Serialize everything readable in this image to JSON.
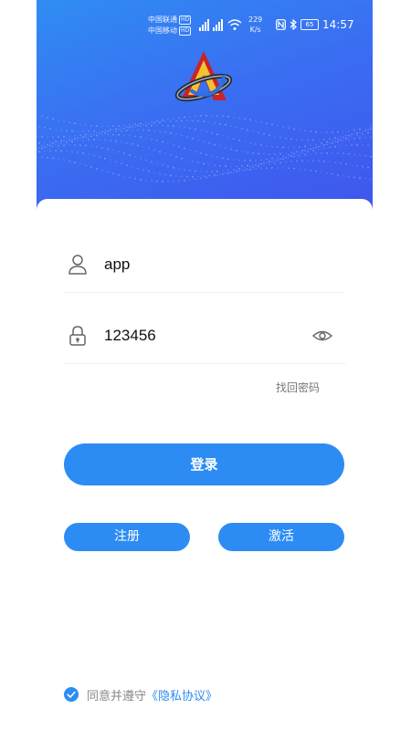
{
  "status_bar": {
    "carrier_1": "中国联通",
    "carrier_2": "中国移动",
    "hd_badge": "HD",
    "net_speed_value": "229",
    "net_speed_unit": "K/s",
    "battery_level": "65",
    "time": "14:57"
  },
  "login_form": {
    "username_value": "app",
    "password_value": "123456",
    "forgot_password_label": "找回密码",
    "login_button_label": "登录",
    "register_button_label": "注册",
    "activate_button_label": "激活"
  },
  "agreement": {
    "checked": true,
    "text": "同意并遵守",
    "link_text": "《隐私协议》"
  },
  "colors": {
    "primary": "#2c8cf4",
    "hero_gradient_start": "#2f8df3",
    "hero_gradient_end": "#3f55ee"
  },
  "icons": {
    "user": "user-icon",
    "lock": "lock-icon",
    "eye": "eye-icon",
    "check": "check-circle-icon",
    "logo": "app-logo"
  }
}
